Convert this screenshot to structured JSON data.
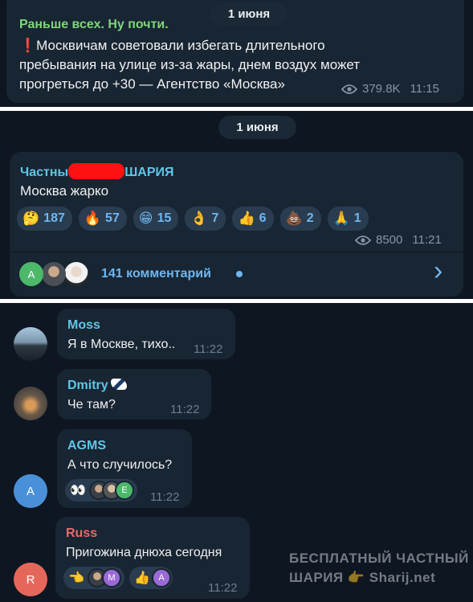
{
  "panel1": {
    "date": "1 июня",
    "channel": "Раньше всех. Ну почти.",
    "alert_icon": "❗",
    "text": "Москвичам советовали избегать длительного пребывания на улице из-за жары, днем воздух может прогреться до +30 — Агентство «Москва»",
    "views": "379.8K",
    "time": "11:15"
  },
  "panel2": {
    "date": "1 июня",
    "channel_left": "Частны",
    "channel_right": "ШАРИЯ",
    "text": "Москва жарко",
    "reactions": [
      {
        "emoji": "🤔",
        "count": "187"
      },
      {
        "emoji": "🔥",
        "count": "57"
      },
      {
        "emoji": "😁",
        "count": "15"
      },
      {
        "emoji": "👌",
        "count": "7"
      },
      {
        "emoji": "👍",
        "count": "6"
      },
      {
        "emoji": "💩",
        "count": "2"
      },
      {
        "emoji": "🙏",
        "count": "1"
      }
    ],
    "views": "8500",
    "time": "11:21",
    "comments_label": "141 комментарий",
    "comment_avatar_letter": "A",
    "chevron": "›"
  },
  "comments": [
    {
      "name": "Moss",
      "text": "Я в Москве, тихо..",
      "time": "11:22",
      "color": "#5fc7e6"
    },
    {
      "name": "Dmitry",
      "text": "Че там?",
      "time": "11:22",
      "color": "#5fc7e6"
    },
    {
      "name": "AGMS",
      "text": "А что случилось?",
      "time": "11:22",
      "color": "#5fc7e6",
      "avatar_letter": "A",
      "reaction_emoji": "👀",
      "reactor_letter": "E"
    },
    {
      "name": "Russ",
      "text": "Пригожина днюха сегодня",
      "time": "11:22",
      "color": "#e96a6a",
      "avatar_letter": "R",
      "reaction1_emoji": "👈",
      "reaction1_letter": "M",
      "reaction2_emoji": "👍",
      "reaction2_letter": "A"
    }
  ],
  "watermark": {
    "line1": "БЕСПЛАТНЫЙ ЧАСТНЫЙ",
    "line2_left": "ШАРИЯ",
    "line2_hand": "👉",
    "line2_right": "Sharij.net"
  },
  "colors": {
    "background": "#0e1621",
    "bubble": "#182533",
    "accent_blue": "#6fb7f0",
    "channel_green": "#7ed67a",
    "channel_cyan": "#5fc7e6"
  }
}
